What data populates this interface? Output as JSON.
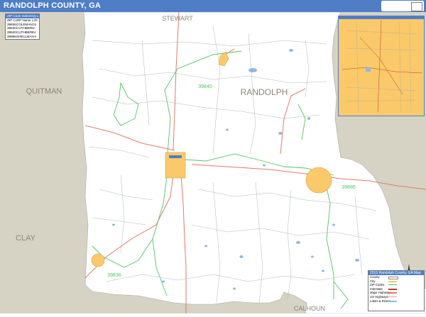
{
  "header": {
    "title": "RANDOLPH COUNTY, GA"
  },
  "colors": {
    "title_bar": "#4f7ec7",
    "county_fill": "#ffffff",
    "neighbor_fill": "#d6d2c4",
    "city_fill": "#fac96a",
    "water": "#8fb8e0",
    "highway": "#e07b6a",
    "zip_boundary": "#55c266",
    "minor_road": "#9aa3ad"
  },
  "neighbors": {
    "north": "STEWART",
    "west_upper": "QUITMAN",
    "west_lower": "CLAY",
    "south": "CALHOUN"
  },
  "county_label": "RANDOLPH",
  "zip_labels": [
    "39840",
    "39886",
    "39836"
  ],
  "legend": {
    "heading": "ZIP Code Index/City Locator",
    "columns": [
      "ZIP Code",
      "ZIP Name",
      "LOC"
    ],
    "rows": [
      [
        "39836",
        "COLEMAN",
        "C6"
      ],
      [
        "39840",
        "CUTHBERT",
        "I2"
      ],
      [
        "39840",
        "CUTHBERT",
        "E4"
      ],
      [
        "39886",
        "SHELLMAN",
        "H4"
      ]
    ]
  },
  "map_info": {
    "heading": "2016 Randolph County, GA Map",
    "rows": [
      "County",
      "City",
      "ZIP Codes",
      "Interstate",
      "Major Highways",
      "US Highways",
      "Lakes & Rivers"
    ]
  },
  "icons": {
    "compass": "compass-rose-icon"
  }
}
